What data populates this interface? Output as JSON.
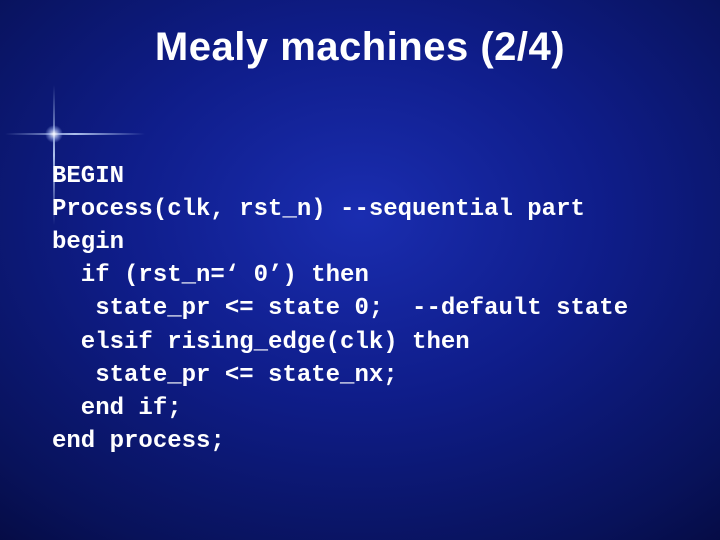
{
  "slide": {
    "title": "Mealy machines (2/4)",
    "code": {
      "l1": "BEGIN",
      "l2": "Process(clk, rst_n) --sequential part",
      "l3": "begin",
      "l4": "  if (rst_n=‘ 0’) then",
      "l5": "   state_pr <= state 0;  --default state",
      "l6": "  elsif rising_edge(clk) then",
      "l7": "   state_pr <= state_nx;",
      "l8": "  end if;",
      "l9": "end process;"
    }
  }
}
